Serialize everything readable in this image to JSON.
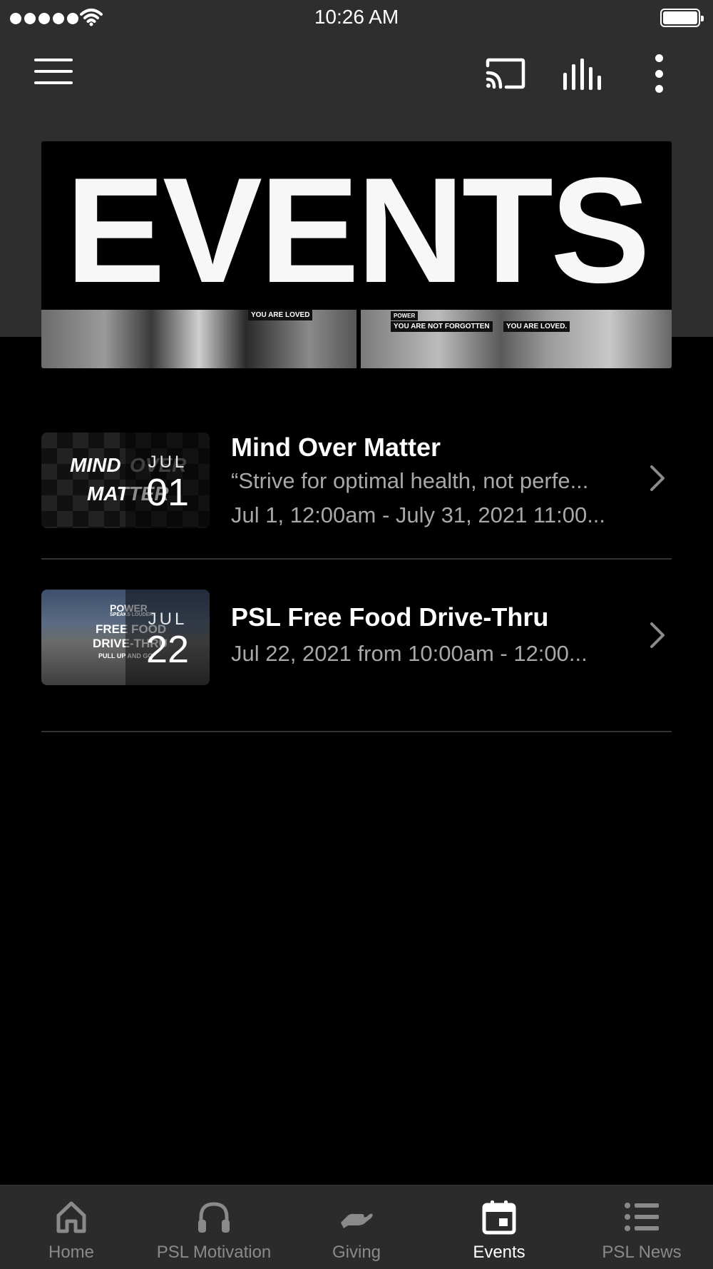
{
  "status_bar": {
    "time": "10:26 AM"
  },
  "nav": {
    "icons": [
      "menu-icon",
      "cast-icon",
      "audio-bars-icon",
      "more-vertical-icon"
    ]
  },
  "banner": {
    "title": "EVENTS",
    "photo_captions": [
      "YOU ARE LOVED",
      "POWER",
      "YOU ARE NOT FORGOTTEN",
      "YOU ARE LOVED."
    ]
  },
  "events": [
    {
      "thumb_text_line1": "MIND",
      "thumb_text_line2": "MATTER",
      "thumb_text_over": "OVER",
      "month": "JUL",
      "day": "01",
      "title": "Mind Over Matter",
      "subtitle": "“Strive for optimal health, not perfe...",
      "date_text": "Jul 1, 12:00am - July 31, 2021 11:00..."
    },
    {
      "thumb_brand": "POWER",
      "thumb_brand_sub": "SPEAKS LOUDER",
      "thumb_text_line1": "FREE FOOD",
      "thumb_text_line2": "DRIVE-THRU",
      "thumb_text_line3": "PULL UP AND GO",
      "month": "JUL",
      "day": "22",
      "title": "PSL Free Food Drive-Thru",
      "date_text": "Jul 22, 2021 from 10:00am - 12:00..."
    }
  ],
  "tabs": [
    {
      "label": "Home",
      "icon": "home-icon",
      "active": false
    },
    {
      "label": "PSL Motivation",
      "icon": "headphones-icon",
      "active": false
    },
    {
      "label": "Giving",
      "icon": "giving-hand-icon",
      "active": false
    },
    {
      "label": "Events",
      "icon": "calendar-icon",
      "active": true
    },
    {
      "label": "PSL News",
      "icon": "list-icon",
      "active": false
    }
  ],
  "colors": {
    "background": "#000000",
    "header": "#2e2e2e",
    "tab_bar": "#2b2b2b",
    "inactive_tab": "#8a8a8a",
    "secondary_text": "#a8a8a8"
  }
}
